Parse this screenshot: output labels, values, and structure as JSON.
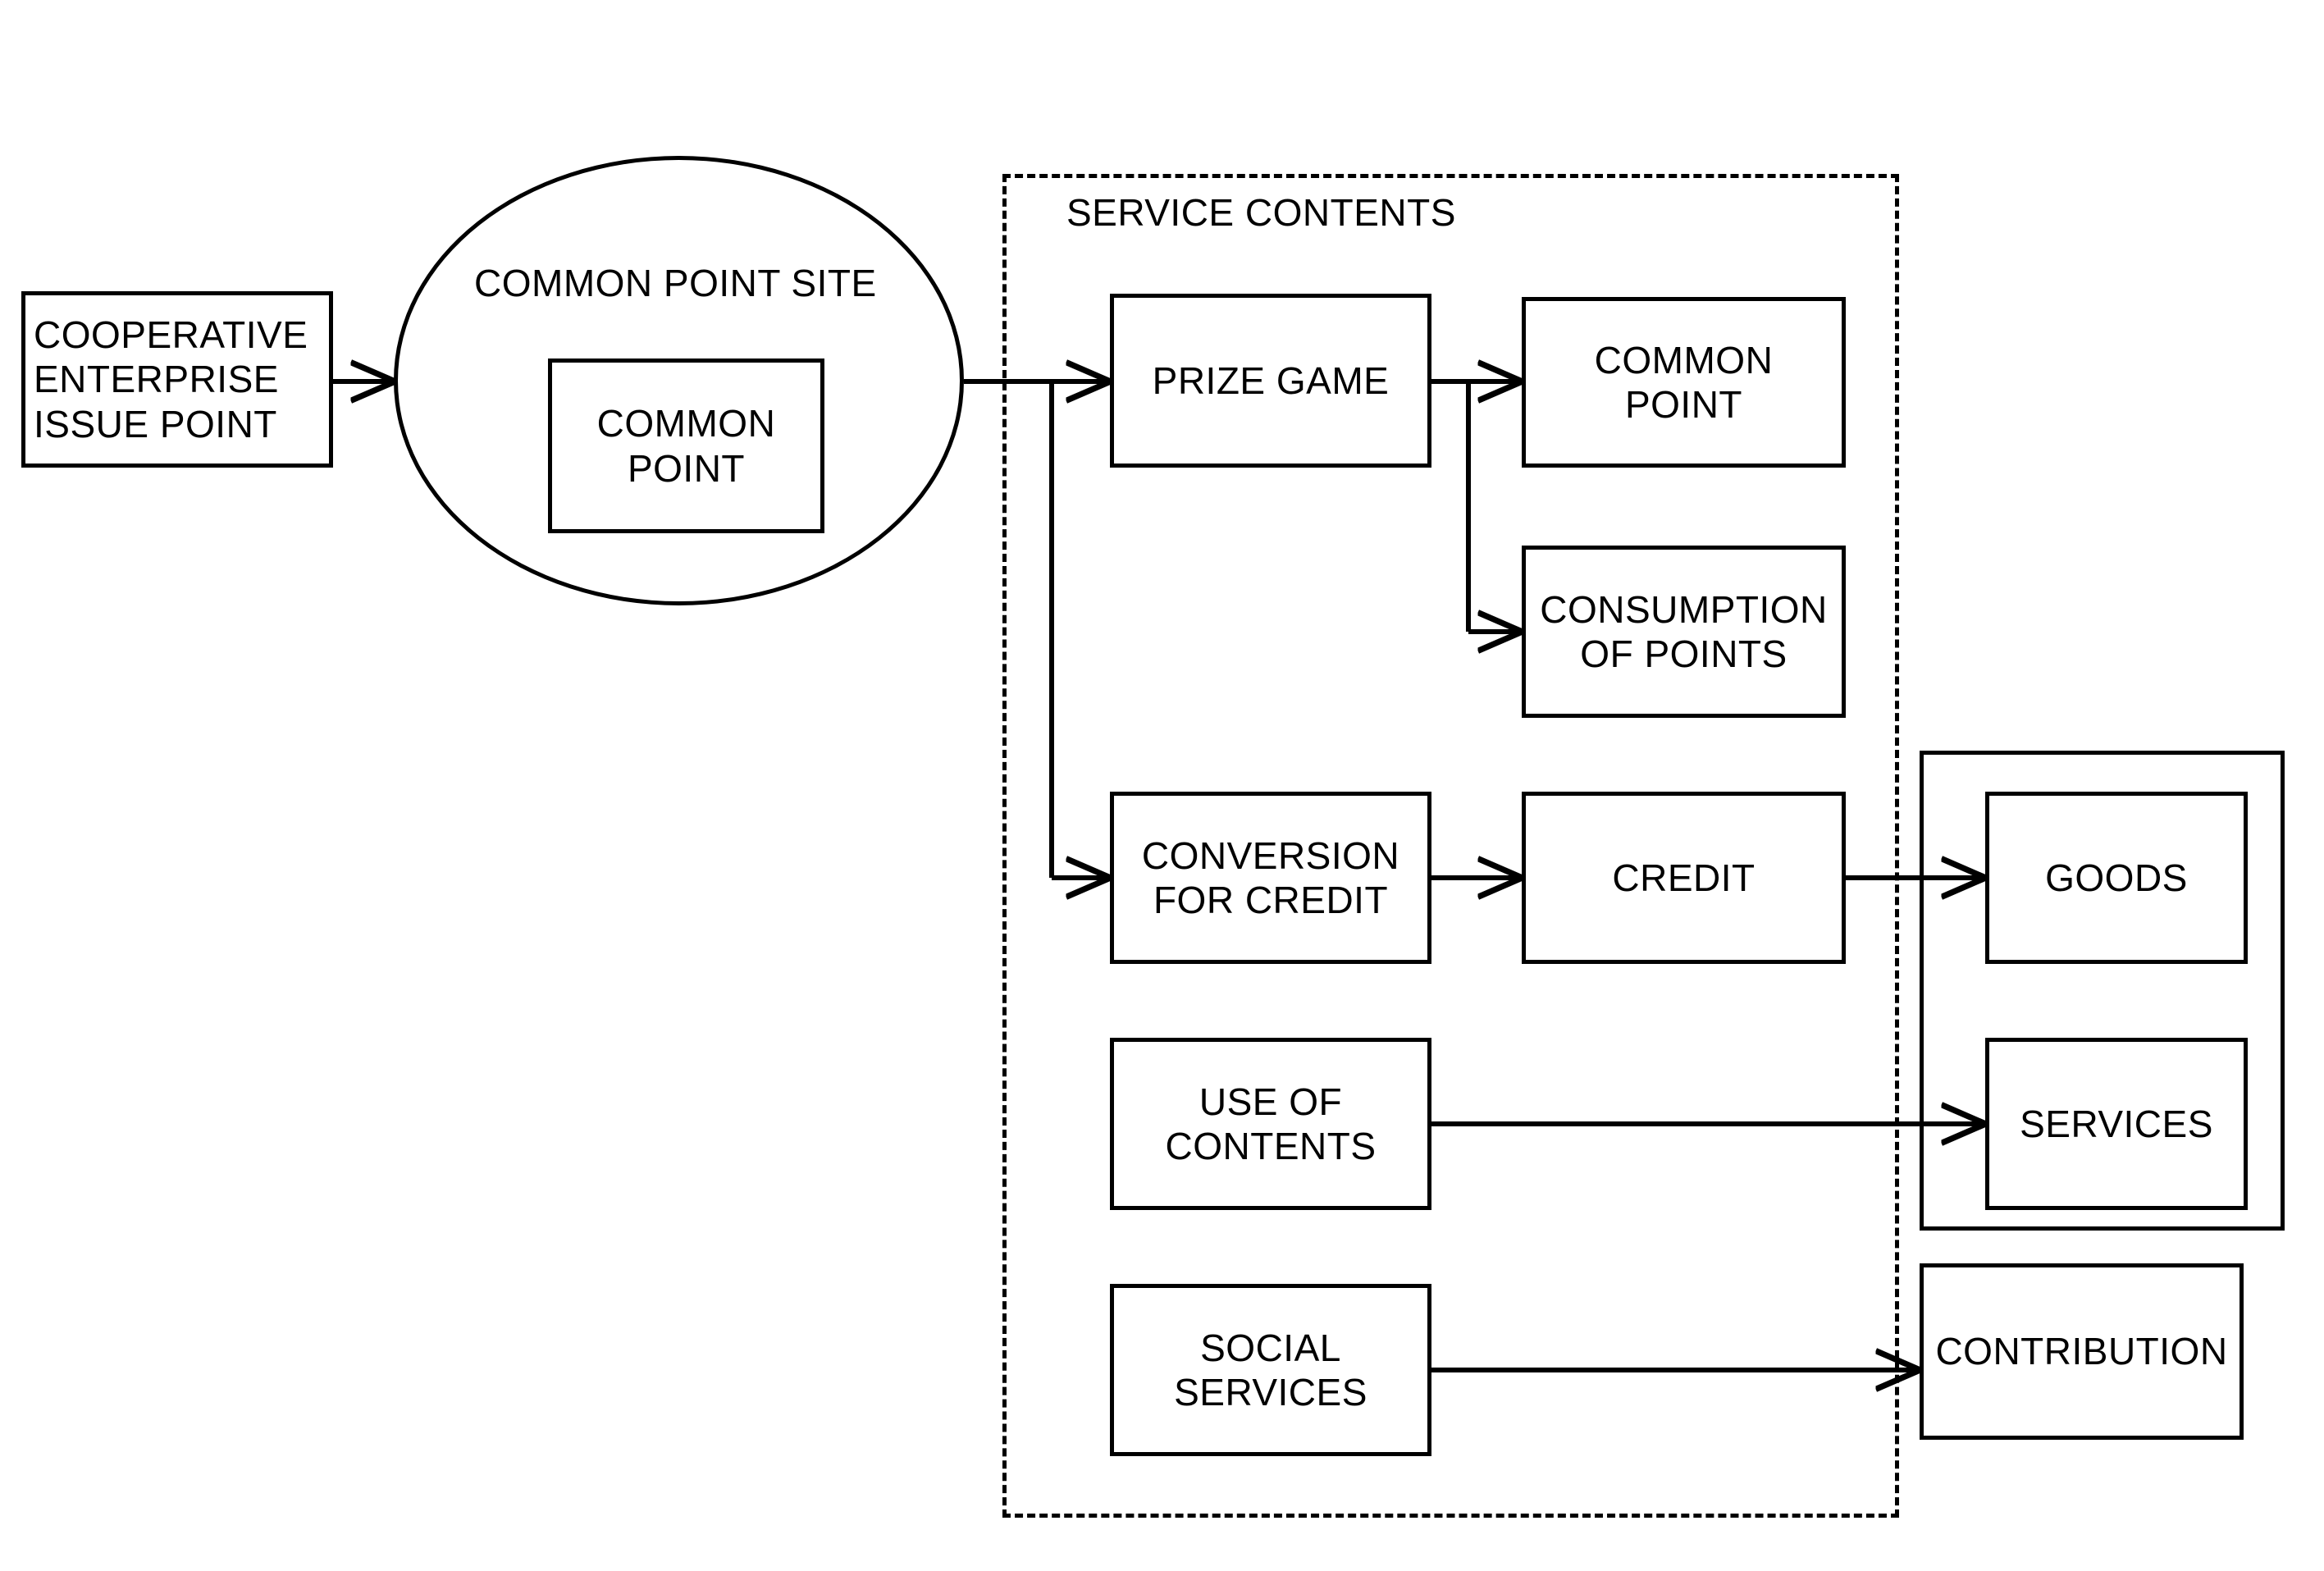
{
  "diagram": {
    "title_labels": {
      "service_contents": "SERVICE CONTENTS",
      "common_point_site": "COMMON POINT SITE"
    },
    "nodes": {
      "cooperative_enterprise_issue_point": "COOPERATIVE\nENTERPRISE\nISSUE POINT",
      "common_point_inner": "COMMON\nPOINT",
      "prize_game": "PRIZE GAME",
      "common_point_out": "COMMON\nPOINT",
      "consumption_of_points": "CONSUMPTION\nOF POINTS",
      "conversion_for_credit": "CONVERSION\nFOR CREDIT",
      "credit": "CREDIT",
      "goods": "GOODS",
      "services": "SERVICES",
      "use_of_contents": "USE OF\nCONTENTS",
      "social_services": "SOCIAL\nSERVICES",
      "contribution": "CONTRIBUTION"
    },
    "colors": {
      "stroke": "#000000",
      "fill": "#ffffff"
    },
    "edges": [
      {
        "from": "cooperative_enterprise_issue_point",
        "to": "common_point_site",
        "arrow": true
      },
      {
        "from": "common_point_site",
        "to": "prize_game",
        "arrow": true
      },
      {
        "from": "common_point_site",
        "to": "conversion_for_credit",
        "arrow": true
      },
      {
        "from": "prize_game",
        "to": "common_point_out",
        "arrow": true
      },
      {
        "from": "prize_game",
        "to": "consumption_of_points",
        "arrow": true
      },
      {
        "from": "conversion_for_credit",
        "to": "credit",
        "arrow": true
      },
      {
        "from": "credit",
        "to": "goods",
        "arrow": true
      },
      {
        "from": "use_of_contents",
        "to": "services",
        "arrow": true
      },
      {
        "from": "social_services",
        "to": "contribution",
        "arrow": true
      }
    ]
  }
}
